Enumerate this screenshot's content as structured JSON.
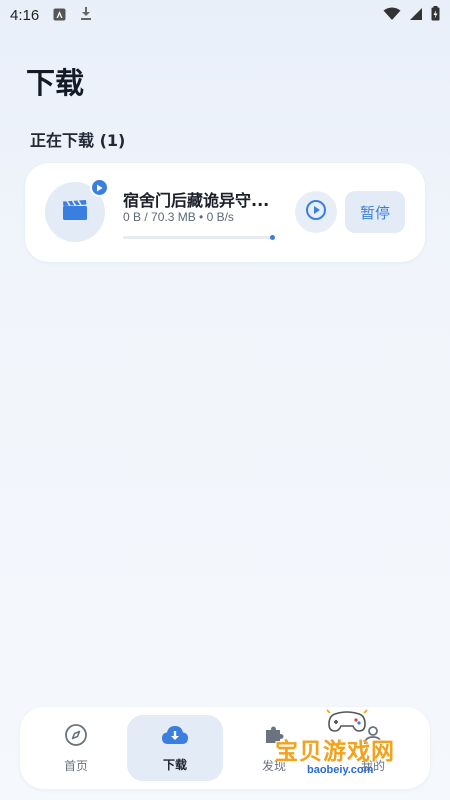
{
  "status_bar": {
    "time": "4:16"
  },
  "page": {
    "title": "下载",
    "section_title": "正在下载 (1)"
  },
  "download_item": {
    "title": "宿舍门后藏诡异守...",
    "meta": "0 B / 70.3 MB • 0 B/s",
    "progress": 0.0,
    "pause_label": "暂停"
  },
  "bottom_nav": {
    "items": [
      {
        "label": "首页",
        "icon": "compass-icon",
        "active": false
      },
      {
        "label": "下载",
        "icon": "cloud-download-icon",
        "active": true
      },
      {
        "label": "发现",
        "icon": "puzzle-icon",
        "active": false
      },
      {
        "label": "我的",
        "icon": "user-icon",
        "active": false
      }
    ]
  },
  "watermark": {
    "text": "宝贝游戏网",
    "url": "baobeiy.com"
  },
  "colors": {
    "accent": "#3a7ee0",
    "watermark": "#f2a21c"
  }
}
